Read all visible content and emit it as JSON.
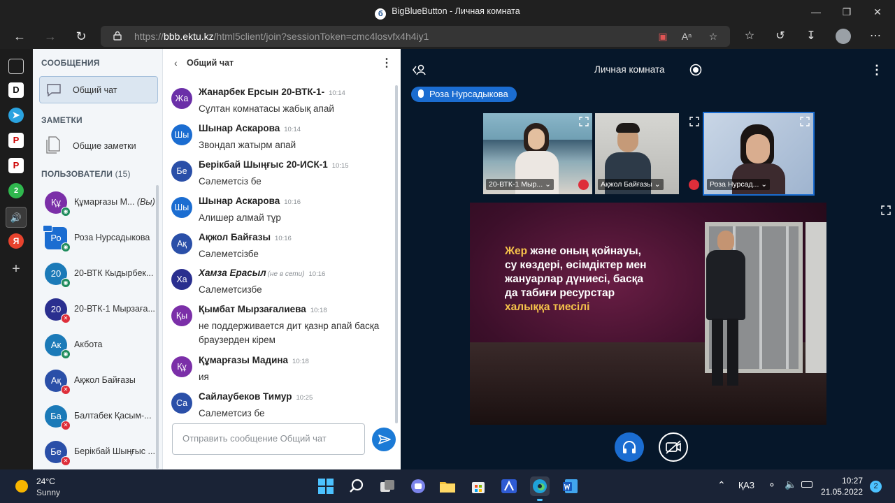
{
  "window": {
    "title": "BigBlueButton - Личная комната"
  },
  "browser": {
    "url_prefix": "https://",
    "url_host": "bbb.ektu.kz",
    "url_path": "/html5client/join?sessionToken=cmc4losvfx4h4iy1"
  },
  "edge_sidebar": {
    "items": [
      "D",
      "P",
      "P",
      "2",
      "Я"
    ]
  },
  "userlist": {
    "messages_header": "СООБЩЕНИЯ",
    "public_chat_label": "Общий чат",
    "notes_header": "ЗАМЕТКИ",
    "shared_notes_label": "Общие заметки",
    "users_header": "ПОЛЬЗОВАТЕЛИ",
    "users_count": "(15)",
    "users": [
      {
        "initials": "Құ",
        "name": "Құмарғазы М...",
        "you": "(Вы)",
        "color": "#7b2fa8",
        "status": "listen"
      },
      {
        "initials": "Ро",
        "name": "Роза Нурсадыкова",
        "color": "#1b6dd1",
        "status": "listen",
        "presenter": true
      },
      {
        "initials": "20",
        "name": "20-ВТК Кыдырбек...",
        "color": "#1b7ab8",
        "status": "listen"
      },
      {
        "initials": "20",
        "name": "20-ВТК-1 Мырзаға...",
        "color": "#2a2f8f",
        "status": "muted"
      },
      {
        "initials": "Ак",
        "name": "Акбота",
        "color": "#1b7ab8",
        "status": "listen"
      },
      {
        "initials": "Ақ",
        "name": "Ақжол Байғазы",
        "color": "#2a4fa8",
        "status": "muted"
      },
      {
        "initials": "Ба",
        "name": "Балтабек Қасым-...",
        "color": "#1b7ab8",
        "status": "muted"
      },
      {
        "initials": "Бе",
        "name": "Берікбай Шыңғыс ...",
        "color": "#2a4fa8",
        "status": "muted"
      }
    ]
  },
  "chat": {
    "title": "Общий чат",
    "input_placeholder": "Отправить сообщение Общий чат",
    "messages": [
      {
        "initials": "Жа",
        "color": "#6b2fa8",
        "name": "Жанарбек Ерсын 20-ВТК-1-",
        "time": "10:14",
        "text": "Сұлтан комнатасы жабық апай"
      },
      {
        "initials": "Шы",
        "color": "#1b6dd1",
        "name": "Шынар Аскарова",
        "time": "10:14",
        "text": "Звондап жатырм апай"
      },
      {
        "initials": "Бе",
        "color": "#2a4fa8",
        "name": "Берікбай Шыңғыс 20-ИСК-1",
        "time": "10:15",
        "text": "Сәлеметсіз бе"
      },
      {
        "initials": "Шы",
        "color": "#1b6dd1",
        "name": "Шынар Аскарова",
        "time": "10:16",
        "text": "Алишер алмай тұр"
      },
      {
        "initials": "Ақ",
        "color": "#2a4fa8",
        "name": "Ақжол Байғазы",
        "time": "10:16",
        "text": "Сәлеметсізбе"
      },
      {
        "initials": "Ха",
        "color": "#2a2f8f",
        "name": "Хамза Ерасыл",
        "offline": "(не в сети)",
        "time": "10:16",
        "text": "Салеметсизбе"
      },
      {
        "initials": "Қы",
        "color": "#7b2fa8",
        "name": "Қымбат Мырзағалиева",
        "time": "10:18",
        "text": "не поддерживается дит қазнр апай басқа браузерден кірем"
      },
      {
        "initials": "Құ",
        "color": "#7b2fa8",
        "name": "Құмарғазы Мадина",
        "time": "10:18",
        "text": "ия"
      },
      {
        "initials": "Са",
        "color": "#2a4fa8",
        "name": "Сайлаубеков Тимур",
        "time": "10:25",
        "text": "Салеметсиз бе"
      }
    ]
  },
  "stage": {
    "room_title": "Личная комната",
    "talking": "Роза Нурсадыкова",
    "videos": [
      {
        "name": "20-ВТК-1 Мыр..."
      },
      {
        "name": "Ақжол Байғазы"
      },
      {
        "name": "Роза Нурсад..."
      }
    ],
    "slide": {
      "line1_highlight": "Жер",
      "line1_rest": " және оның қойнауы,",
      "line2": "су көздері, өсімдіктер мен",
      "line3": "жануарлар дүниесі, басқа",
      "line4": "да табиғи ресурстар",
      "line5_highlight": "халыққа тиесілі"
    }
  },
  "taskbar": {
    "temperature": "24°C",
    "weather": "Sunny",
    "language": "ҚАЗ",
    "time": "10:27",
    "date": "21.05.2022",
    "notifications": "2"
  },
  "colors": {
    "stage_bg": "#06172a",
    "accent": "#1b6dd1",
    "muted": "#de2e3a",
    "listen": "#1e8b5c"
  }
}
